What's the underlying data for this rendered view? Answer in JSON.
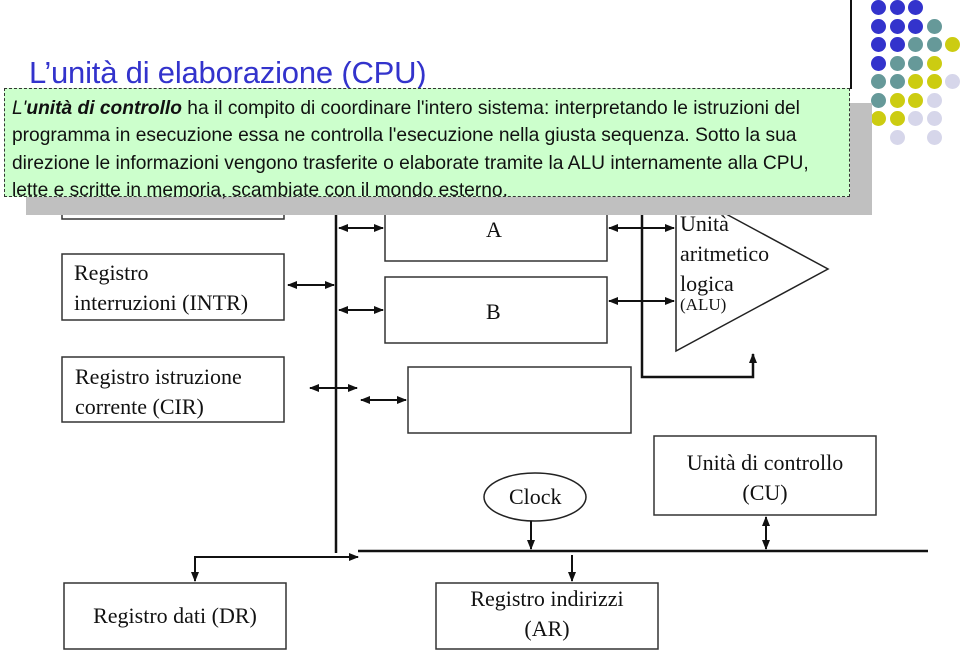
{
  "slide": {
    "title": "L’unità di elaborazione (CPU)",
    "colors": {
      "title": "#3333cc",
      "callout_bg": "#ccffcc",
      "shadow": "#c0c0c0",
      "dot_blue": "#3333cc",
      "dot_teal": "#669999",
      "dot_yellow": "#cccc11",
      "dot_lavender": "#d6d6ea"
    }
  },
  "callout": {
    "lead_prefix": "L'",
    "lead_bold": "unità di controllo",
    "text": " ha il compito di coordinare l'intero sistema: interpretando le istruzioni del programma in esecuzione essa ne controlla l'esecuzione nella giusta sequenza. Sotto la sua direzione le informazioni vengono trasferite o elaborate tramite la ALU internamente alla CPU, lette e scritte in memoria, scambiate con il mondo esterno."
  },
  "decoration": {
    "dot_grid": [
      [
        "blue",
        "blue",
        "blue",
        null,
        null
      ],
      [
        "blue",
        "blue",
        "blue",
        "teal",
        null
      ],
      [
        "blue",
        "blue",
        "teal",
        "teal",
        "yellow"
      ],
      [
        "blue",
        "teal",
        "teal",
        "yellow",
        null
      ],
      [
        "teal",
        "teal",
        "yellow",
        "yellow",
        "lavender"
      ],
      [
        "teal",
        "yellow",
        "yellow",
        "lavender",
        null
      ],
      [
        "yellow",
        "yellow",
        "lavender",
        "lavender",
        null
      ],
      [
        null,
        "lavender",
        null,
        "lavender",
        null
      ]
    ]
  },
  "diagram": {
    "registers": {
      "intr": {
        "line1": "Registro",
        "line2": "interruzioni (INTR)"
      },
      "cir": {
        "line1": "Registro istruzione",
        "line2": "corrente (CIR)"
      },
      "a": {
        "label": "A"
      },
      "b": {
        "label": "B"
      },
      "dr": {
        "label": "Registro dati (DR)"
      },
      "ar": {
        "line1": "Registro indirizzi",
        "line2": "(AR)"
      }
    },
    "alu": {
      "line1": "Unità",
      "line2": "aritmetico",
      "line3": "logica",
      "line4": "(ALU)"
    },
    "clock": {
      "label": "Clock"
    },
    "cu": {
      "line1": "Unità di controllo",
      "line2": "(CU)"
    }
  }
}
